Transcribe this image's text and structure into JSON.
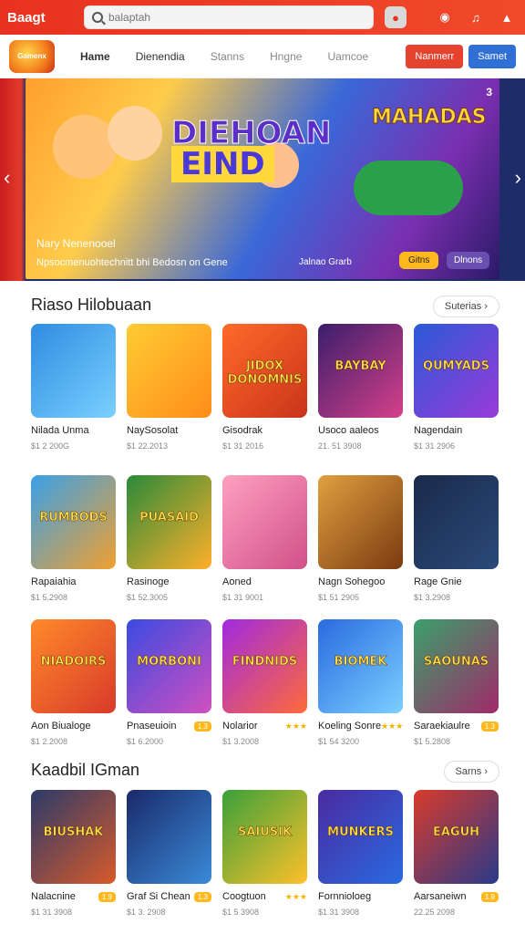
{
  "topbar": {
    "brand": "Baagt",
    "search_placeholder": "balaptah",
    "icons": [
      "search-icon",
      "mic-icon",
      "notification-icon",
      "music-icon",
      "user-icon"
    ]
  },
  "nav": {
    "logo": "Gamenx",
    "links": [
      "Hame",
      "Dienendia",
      "Stanns",
      "Hngne",
      "Uamcoe"
    ],
    "btn_primary": "Nanmerr",
    "btn_secondary": "Samet"
  },
  "hero": {
    "title_line1": "DIEHOAN",
    "title_line2": "EIND",
    "logo2": "MAHADAS",
    "counter": "3",
    "subtitle": "Nary Nenenooel",
    "description": "Npsocmenuohtechnitt bhi Bedosn on Gene",
    "meta": "Jalnao Grarb",
    "btn1": "Gitns",
    "btn2": "Dlnons",
    "colors": {
      "accent": "#ffb91e",
      "secondary": "#6a4fb0"
    }
  },
  "section1": {
    "title": "Riaso Hilobuaan",
    "see_all": "Suterias",
    "cards": [
      {
        "title": "Nilada Unma",
        "meta": "$1 2 200G",
        "art": "",
        "bg": "linear-gradient(135deg,#2f8ce0,#7ad0ff)",
        "tag": ""
      },
      {
        "title": "NaySosolat",
        "meta": "$1 22.2013",
        "art": "",
        "bg": "linear-gradient(135deg,#ffcc33,#ff8c1a)",
        "tag": ""
      },
      {
        "title": "Gisodrak",
        "meta": "$1 31 2016",
        "art": "JIDOX DONOMNIS",
        "bg": "linear-gradient(135deg,#ff6a2a,#c9341a)",
        "tag": ""
      },
      {
        "title": "Usoco aaleos",
        "meta": "21. 51 3908",
        "art": "BAYBAY",
        "bg": "linear-gradient(135deg,#3a1e6a,#d6408a)",
        "tag": ""
      },
      {
        "title": "Nagendain",
        "meta": "$1 31 2906",
        "art": "QUMYADS",
        "bg": "linear-gradient(135deg,#2a5ad8,#9a3ad8)",
        "tag": ""
      }
    ]
  },
  "section2": {
    "cards": [
      {
        "title": "Rapaiahia",
        "meta": "$1 5.2908",
        "art": "RUMBODS",
        "bg": "linear-gradient(135deg,#3aa0e8,#f0a030)",
        "tag": ""
      },
      {
        "title": "Rasinoge",
        "meta": "$1 52.3005",
        "art": "PUASAID",
        "bg": "linear-gradient(135deg,#2a8a3a,#ffb02a)",
        "tag": ""
      },
      {
        "title": "Aoned",
        "meta": "$1 31 9001",
        "art": "",
        "bg": "linear-gradient(135deg,#ffa0c0,#d0508a)",
        "tag": ""
      },
      {
        "title": "Nagn Sohegoo",
        "meta": "$1 51 2905",
        "art": "",
        "bg": "linear-gradient(135deg,#e0a040,#7a3a10)",
        "tag": ""
      },
      {
        "title": "Rage Gnie",
        "meta": "$1 3.2908",
        "art": "",
        "bg": "linear-gradient(135deg,#1a2a4a,#2a4a7a)",
        "tag": ""
      }
    ]
  },
  "section3": {
    "cards": [
      {
        "title": "Aon Biualoge",
        "meta": "$1 2.2008",
        "art": "NIADOIRS",
        "bg": "linear-gradient(135deg,#ff8a2a,#d83a2a)",
        "tag": ""
      },
      {
        "title": "Pnaseuioin",
        "meta": "$1 6.2000",
        "art": "MORBONI",
        "bg": "linear-gradient(135deg,#3a4ae0,#d050c0)",
        "tag": "1.3"
      },
      {
        "title": "Nolarior",
        "meta": "$1 3.2008",
        "art": "FINDNIDS",
        "bg": "linear-gradient(135deg,#a02ae0,#ff6a3a)",
        "tag": "stars"
      },
      {
        "title": "Koeling Sonre",
        "meta": "$1 54 3200",
        "art": "BIOMEK",
        "bg": "linear-gradient(135deg,#2a6ae0,#7ad0ff)",
        "tag": "stars"
      },
      {
        "title": "Saraekiaulre",
        "meta": "$1 5.2808",
        "art": "SAOUNAS",
        "bg": "linear-gradient(135deg,#3aa06a,#a02a6a)",
        "tag": "1.3"
      }
    ]
  },
  "section4": {
    "title": "Kaadbil IGman",
    "see_all": "Sarns",
    "cards": [
      {
        "title": "Nalacnine",
        "meta": "$1 31 3908",
        "art": "BIUSHAK",
        "bg": "linear-gradient(135deg,#2a3a6a,#d85a2a)",
        "tag": "1.9"
      },
      {
        "title": "Graf Si Chean",
        "meta": "$1 3. 2908",
        "art": "",
        "bg": "linear-gradient(135deg,#1a2a6a,#3a8ad8)",
        "tag": "1.3"
      },
      {
        "title": "Coogtuon",
        "meta": "$1 5 3908",
        "art": "SAIUSIK",
        "bg": "linear-gradient(135deg,#3aa03a,#ffc02a)",
        "tag": "stars"
      },
      {
        "title": "Fornnioloeg",
        "meta": "$1 31 3908",
        "art": "MUNKERS",
        "bg": "linear-gradient(135deg,#4a2aa0,#2a6ae0)",
        "tag": ""
      },
      {
        "title": "Aarsaneiwn",
        "meta": "22.25 2098",
        "art": "EAGUH",
        "bg": "linear-gradient(135deg,#d83a2a,#2a3a8a)",
        "tag": "1.9"
      }
    ]
  }
}
